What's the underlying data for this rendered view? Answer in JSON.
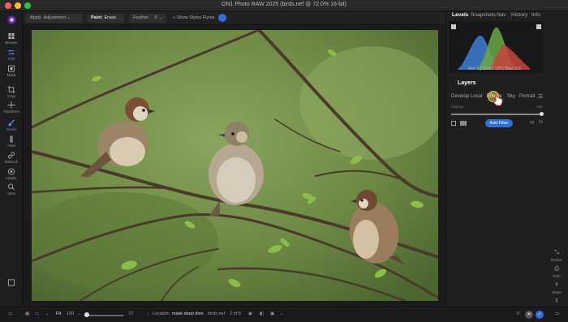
{
  "window": {
    "title": "ON1 Photo RAW 2025 (birds.nef @ 72.0% 16-bit)"
  },
  "toolbar": {
    "apply_label": "Apply",
    "adjustment_value": "Adjustment",
    "paint_label": "Paint",
    "erase_label": "Erase",
    "feather_label": "Feather",
    "feather_value": "0",
    "show_styles_label": "Show Styles Flyout"
  },
  "left_tools": [
    "Browse",
    "Edit",
    "Mask",
    "Crop",
    "Transform",
    "Brush",
    "Heal",
    "Retouch",
    "Liquify",
    "View"
  ],
  "panel": {
    "tabs": [
      "Levels",
      "Snapshots",
      "Nav",
      "History",
      "Info"
    ],
    "histogram_readout": "Red 1  |  Green 125  |  Blue 162",
    "layers_title": "Layers",
    "module_tabs": [
      "Develop",
      "Local",
      "Effects",
      "Sky",
      "Portrait"
    ],
    "opacity_label": "Opacity",
    "opacity_value": "100",
    "add_filter_label": "Add Filter"
  },
  "right_tools": [
    "Resize",
    "Print",
    "Share",
    "Export"
  ],
  "status": {
    "fit_label": "Fit",
    "zoom_value": "100",
    "slider_value": "72",
    "location_label": "Location",
    "location_value": "mask deep dive",
    "filename": "birds.nef",
    "counter": "2 of 8"
  },
  "colors": {
    "accent": "#2f6fdc",
    "close": "#ff5f57",
    "min": "#febc2e",
    "max": "#28c840",
    "histo_red": "#c8423c",
    "histo_green": "#6aa845",
    "histo_blue": "#3d7fd6"
  },
  "icons": [
    "browse-icon",
    "edit-icon",
    "mask-icon",
    "crop-icon",
    "transform-icon",
    "brush-icon",
    "heal-icon",
    "retouch-icon",
    "liquify-icon",
    "view-icon"
  ]
}
